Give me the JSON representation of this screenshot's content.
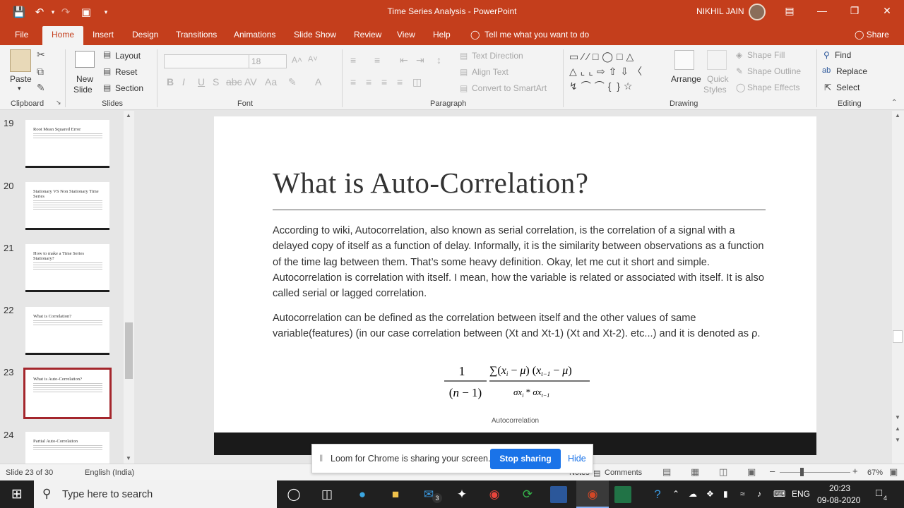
{
  "window": {
    "title": "Time Series Analysis  -  PowerPoint",
    "user": "NIKHIL JAIN"
  },
  "tabs": [
    "File",
    "Home",
    "Insert",
    "Design",
    "Transitions",
    "Animations",
    "Slide Show",
    "Review",
    "View",
    "Help"
  ],
  "active_tab": "Home",
  "tell_me": "Tell me what you want to do",
  "share": "Share",
  "ribbon": {
    "clipboard": {
      "paste": "Paste",
      "label": "Clipboard"
    },
    "slides": {
      "new_slide": "New",
      "new_slide2": "Slide",
      "layout": "Layout",
      "reset": "Reset",
      "section": "Section",
      "label": "Slides"
    },
    "font": {
      "size": "18",
      "label": "Font"
    },
    "paragraph": {
      "text_direction": "Text Direction",
      "align_text": "Align Text",
      "smartart": "Convert to SmartArt",
      "label": "Paragraph"
    },
    "drawing": {
      "arrange": "Arrange",
      "quick_styles": "Quick",
      "quick_styles2": "Styles",
      "shape_fill": "Shape Fill",
      "shape_outline": "Shape Outline",
      "shape_effects": "Shape Effects",
      "label": "Drawing"
    },
    "editing": {
      "find": "Find",
      "replace": "Replace",
      "select": "Select",
      "label": "Editing"
    }
  },
  "thumbnails": [
    {
      "num": "19",
      "title": "Root Mean Squared Error"
    },
    {
      "num": "20",
      "title": "Stationary VS Non Stationary Time Series"
    },
    {
      "num": "21",
      "title": "How to make a Time Series Stationary?"
    },
    {
      "num": "22",
      "title": "What is Correlation?"
    },
    {
      "num": "23",
      "title": "What is Auto-Correlation?"
    },
    {
      "num": "24",
      "title": "Partial Auto-Correlation"
    }
  ],
  "slide": {
    "title": "What is Auto-Correlation?",
    "para1": "According to wiki, Autocorrelation, also known as serial correlation, is the correlation of a signal with a delayed copy of itself as a function of delay. Informally, it is the similarity between observations as a function of the time lag between them. That’s some heavy definition. Okay, let me cut it short and simple. Autocorrelation is correlation with itself. I mean, how the variable is related or associated with itself. It is also called serial or lagged correlation.",
    "para2": "Autocorrelation can be defined as the correlation between itself and the other values of same variable(features) (in our case correlation between (Xt and Xt-1) (Xt and Xt-2). etc...) and it is denoted as ρ.",
    "caption": "Autocorrelation"
  },
  "loom": {
    "message": "Loom for Chrome is sharing your screen.",
    "stop": "Stop sharing",
    "hide": "Hide"
  },
  "status": {
    "slide_of": "Slide 23 of 30",
    "language": "English (India)",
    "notes": "Notes",
    "comments": "Comments",
    "zoom": "67%"
  },
  "taskbar": {
    "search_placeholder": "Type here to search",
    "mail_badge": "3",
    "lang": "ENG",
    "time": "20:23",
    "date": "09-08-2020",
    "notif_count": "4"
  }
}
